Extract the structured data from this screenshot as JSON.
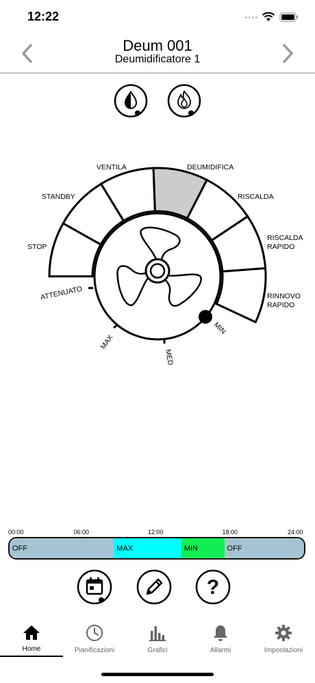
{
  "status_bar": {
    "time": "12:22"
  },
  "header": {
    "title": "Deum 001",
    "subtitle": "Deumidificatore 1"
  },
  "modes": [
    {
      "id": "humidity",
      "icon": "water-drop-icon"
    },
    {
      "id": "heating",
      "icon": "flame-icon"
    }
  ],
  "dial": {
    "segments": [
      {
        "label": "STOP",
        "active": false
      },
      {
        "label": "STANDBY",
        "active": false
      },
      {
        "label": "VENTILA",
        "active": false
      },
      {
        "label": "DEUMIDIFICA",
        "active": true
      },
      {
        "label": "RISCALDA",
        "active": false
      },
      {
        "label": "RISCALDA RAPIDO",
        "line1": "RISCALDA",
        "line2": "RAPIDO",
        "active": false
      },
      {
        "label": "RINNOVO RAPIDO",
        "line1": "RINNOVO",
        "line2": "RAPIDO",
        "active": false
      }
    ],
    "fan_speeds": [
      "ATTENUATO",
      "MAX",
      "MED",
      "MIN"
    ],
    "selected_speed": "MIN",
    "active_color": "#cccccc"
  },
  "timeline": {
    "ticks": [
      "00:00",
      "06:00",
      "12:00",
      "18:00",
      "24:00"
    ],
    "segments": [
      {
        "label": "OFF",
        "start": 0,
        "end": 8.5,
        "color": "#a6c4d4"
      },
      {
        "label": "MAX",
        "start": 8.5,
        "end": 14,
        "color": "#00ffff"
      },
      {
        "label": "MIN",
        "start": 14,
        "end": 17.5,
        "color": "#11ee55"
      },
      {
        "label": "OFF",
        "start": 17.5,
        "end": 24,
        "color": "#a6c4d4"
      }
    ]
  },
  "actions": [
    {
      "id": "calendar",
      "icon": "calendar-icon"
    },
    {
      "id": "edit",
      "icon": "pencil-icon"
    },
    {
      "id": "help",
      "icon": "question-icon"
    }
  ],
  "tabs": [
    {
      "label": "Home",
      "icon": "home-icon",
      "active": true
    },
    {
      "label": "Pianificazioni",
      "icon": "clock-icon",
      "active": false
    },
    {
      "label": "Grafici",
      "icon": "bar-chart-icon",
      "active": false
    },
    {
      "label": "Allarmi",
      "icon": "bell-icon",
      "active": false
    },
    {
      "label": "Impostazioni",
      "icon": "gear-icon",
      "active": false
    }
  ]
}
